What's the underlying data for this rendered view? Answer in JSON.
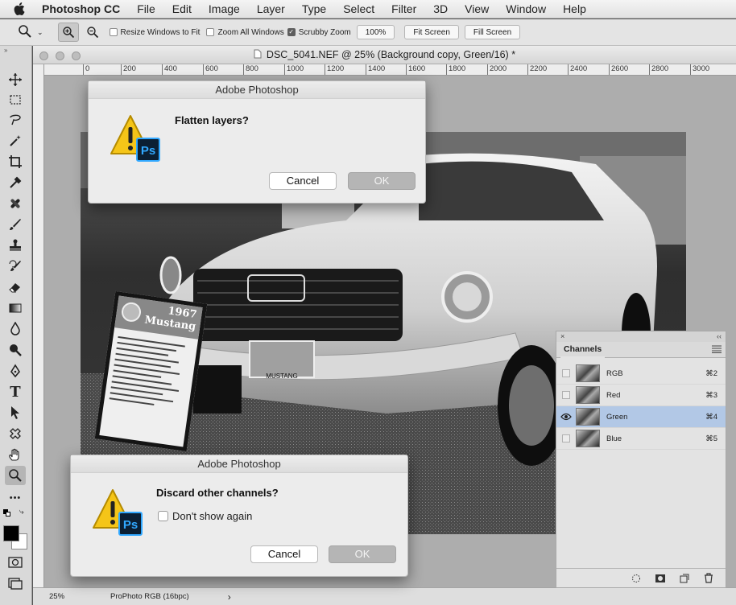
{
  "menubar": {
    "app_name": "Photoshop CC",
    "items": [
      "File",
      "Edit",
      "Image",
      "Layer",
      "Type",
      "Select",
      "Filter",
      "3D",
      "View",
      "Window",
      "Help"
    ]
  },
  "options": {
    "resize_windows_label": "Resize Windows to Fit",
    "resize_windows_checked": false,
    "zoom_all_label": "Zoom All Windows",
    "zoom_all_checked": false,
    "scrubby_label": "Scrubby Zoom",
    "scrubby_checked": true,
    "zoom_percent": "100%",
    "fit_screen_label": "Fit Screen",
    "fill_screen_label": "Fill Screen"
  },
  "document": {
    "title": "DSC_5041.NEF @ 25% (Background copy, Green/16) *",
    "ruler_numbers": [
      "0",
      "200",
      "400",
      "600",
      "800",
      "1000",
      "1200",
      "1400",
      "1600",
      "1800",
      "2000",
      "2200",
      "2400",
      "2600",
      "2800",
      "3000"
    ],
    "zoom": "25%",
    "color_profile": "ProPhoto RGB (16bpc)",
    "status_arrow": "›"
  },
  "dialog_flatten": {
    "title": "Adobe Photoshop",
    "message": "Flatten layers?",
    "cancel_label": "Cancel",
    "ok_label": "OK"
  },
  "dialog_discard": {
    "title": "Adobe Photoshop",
    "message": "Discard other channels?",
    "dont_show_label": "Don't show again",
    "dont_show_checked": false,
    "cancel_label": "Cancel",
    "ok_label": "OK"
  },
  "channels_panel": {
    "tab_label": "Channels",
    "collapse_glyph": "‹‹",
    "close_glyph": "×",
    "rows": [
      {
        "name": "RGB",
        "shortcut": "⌘2",
        "visible": false,
        "selected": false
      },
      {
        "name": "Red",
        "shortcut": "⌘3",
        "visible": false,
        "selected": false
      },
      {
        "name": "Green",
        "shortcut": "⌘4",
        "visible": true,
        "selected": true
      },
      {
        "name": "Blue",
        "shortcut": "⌘5",
        "visible": false,
        "selected": false
      }
    ]
  },
  "sign": {
    "year": "1967",
    "model": "Mustang"
  },
  "plate": "MUSTANG",
  "icons": {
    "ps_badge": "Ps",
    "toolbar_header": "»",
    "more_tools": "•••"
  }
}
